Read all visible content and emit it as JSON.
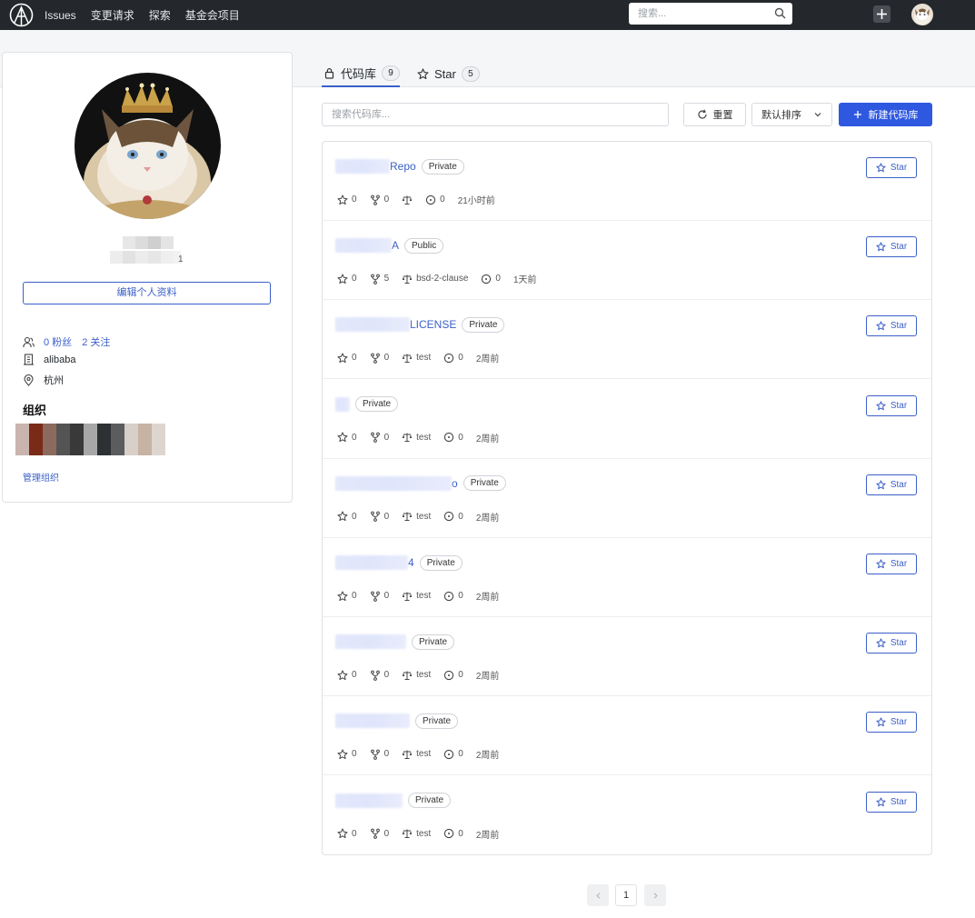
{
  "nav": {
    "links": [
      "Issues",
      "变更请求",
      "探索",
      "基金会项目"
    ],
    "search_placeholder": "搜索..."
  },
  "profile": {
    "name_suffix": "1",
    "edit_label": "编辑个人资料",
    "followers": "0 粉丝",
    "following": "2 关注",
    "company": "alibaba",
    "location": "杭州",
    "org_title": "组织",
    "manage_org": "管理组织"
  },
  "tabs": [
    {
      "label": "代码库",
      "count": "9"
    },
    {
      "label": "Star",
      "count": "5"
    }
  ],
  "filters": {
    "search_placeholder": "搜索代码库...",
    "reset_label": "重置",
    "sort_label": "默认排序",
    "new_repo_label": "新建代码库"
  },
  "repos": [
    {
      "name_visible": "Repo",
      "visibility": "Private",
      "stars": "0",
      "forks": "0",
      "license": "",
      "issues": "0",
      "updated": "21小时前",
      "star_label": "Star"
    },
    {
      "name_visible": "A",
      "visibility": "Public",
      "stars": "0",
      "forks": "5",
      "license": "bsd-2-clause",
      "issues": "0",
      "updated": "1天前",
      "star_label": "Star"
    },
    {
      "name_visible": "LICENSE",
      "visibility": "Private",
      "stars": "0",
      "forks": "0",
      "license": "test",
      "issues": "0",
      "updated": "2周前",
      "star_label": "Star"
    },
    {
      "name_visible": "",
      "visibility": "Private",
      "stars": "0",
      "forks": "0",
      "license": "test",
      "issues": "0",
      "updated": "2周前",
      "star_label": "Star"
    },
    {
      "name_visible": "o",
      "visibility": "Private",
      "stars": "0",
      "forks": "0",
      "license": "test",
      "issues": "0",
      "updated": "2周前",
      "star_label": "Star"
    },
    {
      "name_visible": "4",
      "visibility": "Private",
      "stars": "0",
      "forks": "0",
      "license": "test",
      "issues": "0",
      "updated": "2周前",
      "star_label": "Star"
    },
    {
      "name_visible": "",
      "visibility": "Private",
      "stars": "0",
      "forks": "0",
      "license": "test",
      "issues": "0",
      "updated": "2周前",
      "star_label": "Star"
    },
    {
      "name_visible": "",
      "visibility": "Private",
      "stars": "0",
      "forks": "0",
      "license": "test",
      "issues": "0",
      "updated": "2周前",
      "star_label": "Star"
    },
    {
      "name_visible": "",
      "visibility": "Private",
      "stars": "0",
      "forks": "0",
      "license": "test",
      "issues": "0",
      "updated": "2周前",
      "star_label": "Star"
    }
  ],
  "pagination": {
    "current": "1"
  },
  "colors": {
    "accent": "#3b5fc9",
    "primary_button": "#2f58e0",
    "nav_bg": "#24272b"
  }
}
